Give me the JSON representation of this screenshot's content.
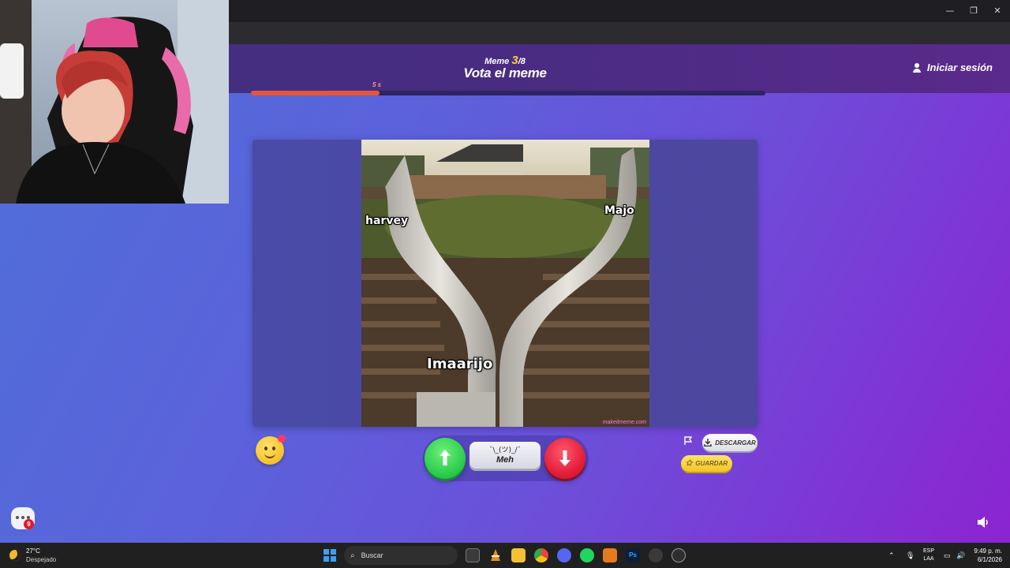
{
  "window": {
    "minimize": "—",
    "restore": "❐",
    "close": "✕"
  },
  "toolbar_icons": [
    "eye-off-icon",
    "cast-icon",
    "star-icon",
    "extensions-icon",
    "profile-icon",
    "menu-icon"
  ],
  "header": {
    "counter_prefix": "Meme",
    "counter_current": "3",
    "counter_total": "/8",
    "title": "Vota el meme",
    "login_label": "Iniciar sesión"
  },
  "timer": {
    "label": "5 s",
    "progress": 0.25,
    "color": "#e8553a"
  },
  "meme": {
    "labels": [
      "harvey",
      "Majo",
      "Imaarijo"
    ],
    "watermark": "makeitmeme.com"
  },
  "vote": {
    "kaomoji": "¯\\_(ツ)_/¯",
    "meh_label": "Meh",
    "up_color": "#2fcf4f",
    "down_color": "#e51f3a"
  },
  "actions": {
    "download_label": "DESCARGAR",
    "save_label": "GUARDAR"
  },
  "chat": {
    "badge": "9"
  },
  "taskbar": {
    "temperature": "27°C",
    "weather": "Despejado",
    "search_placeholder": "Buscar",
    "lang_1": "ESP",
    "lang_2": "LAA",
    "time": "9:49 p. m.",
    "date": "6/1/2026"
  }
}
